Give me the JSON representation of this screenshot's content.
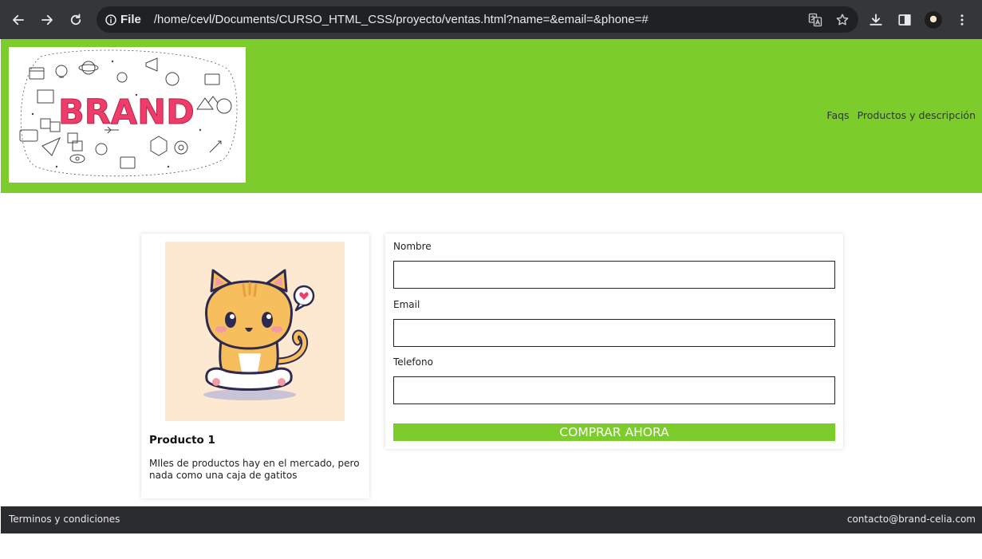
{
  "browser": {
    "scheme_label": "File",
    "url": "/home/cevl/Documents/CURSO_HTML_CSS/proyecto/ventas.html?name=&email=&phone=#"
  },
  "site": {
    "brand_color": "#7ccd2c",
    "logo_text": "BRAND",
    "nav": [
      "Faqs",
      "Productos y descripción"
    ]
  },
  "product": {
    "title": "Producto 1",
    "description": "MIles de productos hay en el mercado, pero nada como una caja de gatitos",
    "image": "cute-cat-illustration"
  },
  "form": {
    "name_label": "Nombre",
    "name_value": "",
    "email_label": "Email",
    "email_value": "",
    "phone_label": "Telefono",
    "phone_value": "",
    "submit_label": "COMPRAR AHORA"
  },
  "footer": {
    "left": "Terminos y condiciones",
    "right": "contacto@brand-celia.com"
  }
}
